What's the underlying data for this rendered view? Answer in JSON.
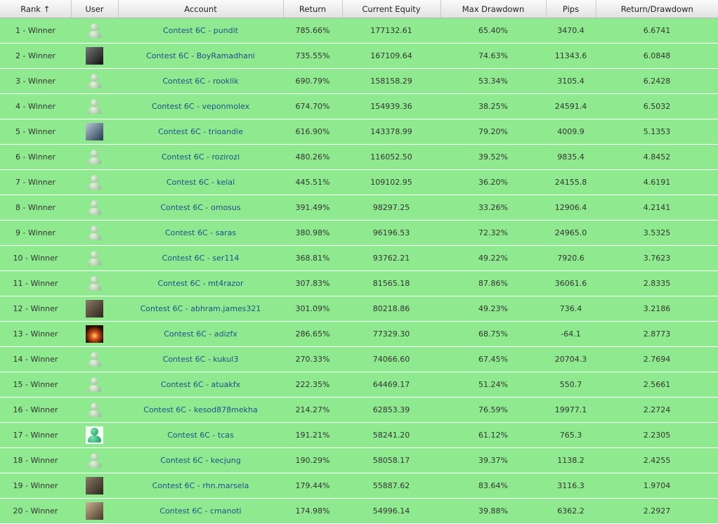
{
  "headers": [
    "Rank ↑",
    "User",
    "Account",
    "Return",
    "Current Equity",
    "Max Drawdown",
    "Pips",
    "Return/Drawdown"
  ],
  "rows": [
    {
      "rank": "1 - Winner",
      "account": "Contest 6C - pundit",
      "return": "785.66%",
      "equity": "177132.61",
      "drawdown": "65.40%",
      "pips": "3470.4",
      "rdd": "6.6741",
      "avatar": "default-user-icon"
    },
    {
      "rank": "2 - Winner",
      "account": "Contest 6C - BoyRamadhani",
      "return": "735.55%",
      "equity": "167109.64",
      "drawdown": "74.63%",
      "pips": "11343.6",
      "rdd": "6.0848",
      "avatar": "photo-avatar"
    },
    {
      "rank": "3 - Winner",
      "account": "Contest 6C - rooklik",
      "return": "690.79%",
      "equity": "158158.29",
      "drawdown": "53.34%",
      "pips": "3105.4",
      "rdd": "6.2428",
      "avatar": "default-user-icon"
    },
    {
      "rank": "4 - Winner",
      "account": "Contest 6C - veponmolex",
      "return": "674.70%",
      "equity": "154939.36",
      "drawdown": "38.25%",
      "pips": "24591.4",
      "rdd": "6.5032",
      "avatar": "default-user-icon"
    },
    {
      "rank": "5 - Winner",
      "account": "Contest 6C - trioandie",
      "return": "616.90%",
      "equity": "143378.99",
      "drawdown": "79.20%",
      "pips": "4009.9",
      "rdd": "5.1353",
      "avatar": "photo-avatar"
    },
    {
      "rank": "6 - Winner",
      "account": "Contest 6C - rozirozi",
      "return": "480.26%",
      "equity": "116052.50",
      "drawdown": "39.52%",
      "pips": "9835.4",
      "rdd": "4.8452",
      "avatar": "default-user-icon"
    },
    {
      "rank": "7 - Winner",
      "account": "Contest 6C - kelal",
      "return": "445.51%",
      "equity": "109102.95",
      "drawdown": "36.20%",
      "pips": "24155.8",
      "rdd": "4.6191",
      "avatar": "default-user-icon"
    },
    {
      "rank": "8 - Winner",
      "account": "Contest 6C - omosus",
      "return": "391.49%",
      "equity": "98297.25",
      "drawdown": "33.26%",
      "pips": "12906.4",
      "rdd": "4.2141",
      "avatar": "default-user-icon"
    },
    {
      "rank": "9 - Winner",
      "account": "Contest 6C - saras",
      "return": "380.98%",
      "equity": "96196.53",
      "drawdown": "72.32%",
      "pips": "24965.0",
      "rdd": "3.5325",
      "avatar": "default-user-icon"
    },
    {
      "rank": "10 - Winner",
      "account": "Contest 6C - ser114",
      "return": "368.81%",
      "equity": "93762.21",
      "drawdown": "49.22%",
      "pips": "7920.6",
      "rdd": "3.7623",
      "avatar": "default-user-icon"
    },
    {
      "rank": "11 - Winner",
      "account": "Contest 6C - mt4razor",
      "return": "307.83%",
      "equity": "81565.18",
      "drawdown": "87.86%",
      "pips": "36061.6",
      "rdd": "2.8335",
      "avatar": "default-user-icon"
    },
    {
      "rank": "12 - Winner",
      "account": "Contest 6C - abhram.james321",
      "return": "301.09%",
      "equity": "80218.86",
      "drawdown": "49.23%",
      "pips": "736.4",
      "rdd": "3.2186",
      "avatar": "photo-avatar"
    },
    {
      "rank": "13 - Winner",
      "account": "Contest 6C - adizfx",
      "return": "286.65%",
      "equity": "77329.30",
      "drawdown": "68.75%",
      "pips": "-64.1",
      "rdd": "2.8773",
      "avatar": "photo-avatar"
    },
    {
      "rank": "14 - Winner",
      "account": "Contest 6C - kukul3",
      "return": "270.33%",
      "equity": "74066.60",
      "drawdown": "67.45%",
      "pips": "20704.3",
      "rdd": "2.7694",
      "avatar": "default-user-icon"
    },
    {
      "rank": "15 - Winner",
      "account": "Contest 6C - atuakfx",
      "return": "222.35%",
      "equity": "64469.17",
      "drawdown": "51.24%",
      "pips": "550.7",
      "rdd": "2.5661",
      "avatar": "default-user-icon"
    },
    {
      "rank": "16 - Winner",
      "account": "Contest 6C - kesod878mekha",
      "return": "214.27%",
      "equity": "62853.39",
      "drawdown": "76.59%",
      "pips": "19977.1",
      "rdd": "2.2724",
      "avatar": "default-user-icon"
    },
    {
      "rank": "17 - Winner",
      "account": "Contest 6C - tcas",
      "return": "191.21%",
      "equity": "58241.20",
      "drawdown": "61.12%",
      "pips": "765.3",
      "rdd": "2.2305",
      "avatar": "green-user-icon"
    },
    {
      "rank": "18 - Winner",
      "account": "Contest 6C - kecjung",
      "return": "190.29%",
      "equity": "58058.17",
      "drawdown": "39.37%",
      "pips": "1138.2",
      "rdd": "2.4255",
      "avatar": "default-user-icon"
    },
    {
      "rank": "19 - Winner",
      "account": "Contest 6C - rhn.marsela",
      "return": "179.44%",
      "equity": "55887.62",
      "drawdown": "83.64%",
      "pips": "3116.3",
      "rdd": "1.9704",
      "avatar": "photo-avatar"
    },
    {
      "rank": "20 - Winner",
      "account": "Contest 6C - cmanoti",
      "return": "174.98%",
      "equity": "54996.14",
      "drawdown": "39.88%",
      "pips": "6362.2",
      "rdd": "2.2927",
      "avatar": "photo-avatar"
    }
  ]
}
